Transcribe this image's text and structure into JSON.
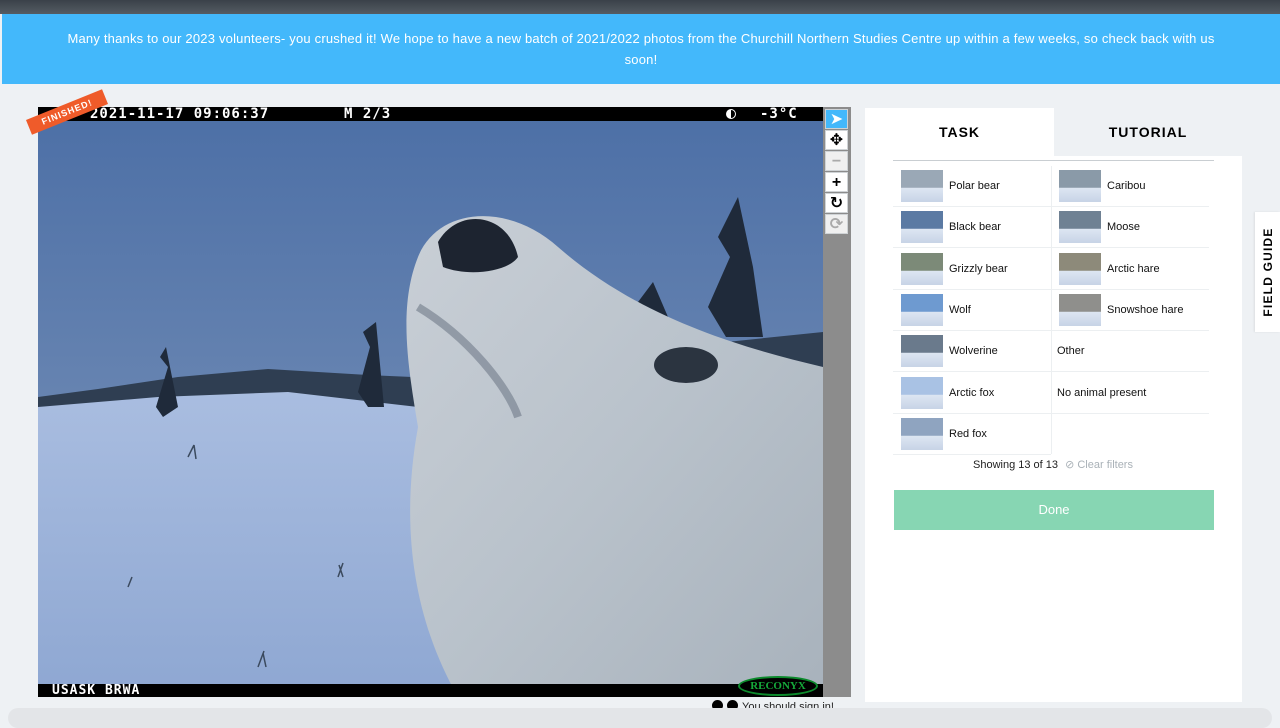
{
  "banner": {
    "line1": "Many thanks to our 2023 volunteers- you crushed it! We hope to have a new batch of 2021/2022 photos from the Churchill Northern Studies Centre up within a few weeks, so check back with us",
    "line2": "soon!"
  },
  "subject": {
    "finished_badge": "FINISHED!",
    "camera_timestamp": "2021-11-17 09:06:37",
    "camera_frame": "M 2/3",
    "camera_temp": "-3°C",
    "camera_site": "USASK BRWA",
    "camera_brand": "RECONYX"
  },
  "toolbar": {
    "select_icon": "arrow-cursor-icon",
    "move_icon": "move-icon",
    "zoom_out_icon": "minus-icon",
    "zoom_in_icon": "plus-icon",
    "rotate_icon": "rotate-icon",
    "reset_icon": "reset-icon"
  },
  "tabs": {
    "task": "TASK",
    "tutorial": "TUTORIAL"
  },
  "choices": [
    {
      "label": "Polar bear",
      "thumb": "#9aa8b6"
    },
    {
      "label": "Caribou",
      "thumb": "#8a9aa8"
    },
    {
      "label": "Black bear",
      "thumb": "#5b7aa3"
    },
    {
      "label": "Moose",
      "thumb": "#6f8193"
    },
    {
      "label": "Grizzly bear",
      "thumb": "#7c8a78"
    },
    {
      "label": "Arctic hare",
      "thumb": "#8d8a7a"
    },
    {
      "label": "Wolf",
      "thumb": "#6e9ad0"
    },
    {
      "label": "Snowshoe hare",
      "thumb": "#8f8f8c"
    },
    {
      "label": "Wolverine",
      "thumb": "#6a7a8c"
    },
    {
      "label": "Other",
      "thumb": ""
    },
    {
      "label": "Arctic fox",
      "thumb": "#a9c2e4"
    },
    {
      "label": "No animal present",
      "thumb": ""
    },
    {
      "label": "Red fox",
      "thumb": "#8fa4c0"
    }
  ],
  "filter": {
    "showing": "Showing 13 of 13",
    "clear": "⊘ Clear filters"
  },
  "done_label": "Done",
  "signin_text": "You should sign in!",
  "field_guide": "FIELD GUIDE"
}
